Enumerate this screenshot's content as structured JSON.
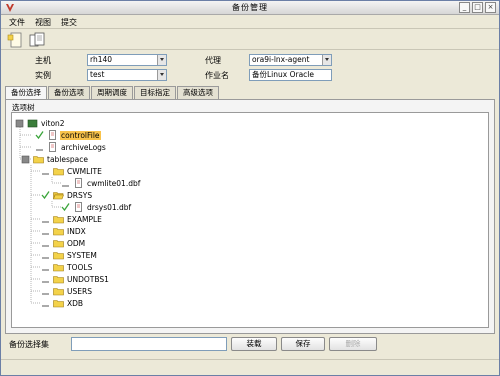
{
  "window": {
    "title": "备份管理",
    "buttons": {
      "minimize": "_",
      "maximize": "□",
      "close": "×"
    }
  },
  "menu": {
    "file": "文件",
    "view": "视图",
    "submit": "提交"
  },
  "toolbar": {
    "icons": [
      "new-doc-icon",
      "docs-icon"
    ]
  },
  "form": {
    "host_label": "主机",
    "host_value": "rh140",
    "agent_label": "代理",
    "agent_value": "ora9i-lnx-agent",
    "instance_label": "实例",
    "instance_value": "test",
    "job_label": "作业名",
    "job_value": "备份Linux Oracle"
  },
  "tabs": [
    "备份选择",
    "备份选项",
    "周期调度",
    "目标指定",
    "高级选项"
  ],
  "tree": {
    "group_label": "选项树",
    "nodes": [
      {
        "label": "viton2",
        "type": "db",
        "checked": "partial"
      },
      {
        "label": "controlFile",
        "type": "file",
        "checked": true,
        "selected": true
      },
      {
        "label": "archiveLogs",
        "type": "file",
        "checked": false
      },
      {
        "label": "tablespace",
        "type": "folder",
        "checked": "partial"
      },
      {
        "label": "CWMLITE",
        "type": "folder",
        "checked": false
      },
      {
        "label": "cwmlite01.dbf",
        "type": "file",
        "checked": false
      },
      {
        "label": "DRSYS",
        "type": "folder-open",
        "checked": true
      },
      {
        "label": "drsys01.dbf",
        "type": "file",
        "checked": true
      },
      {
        "label": "EXAMPLE",
        "type": "folder",
        "checked": false
      },
      {
        "label": "INDX",
        "type": "folder",
        "checked": false
      },
      {
        "label": "ODM",
        "type": "folder",
        "checked": false
      },
      {
        "label": "SYSTEM",
        "type": "folder",
        "checked": false
      },
      {
        "label": "TOOLS",
        "type": "folder",
        "checked": false
      },
      {
        "label": "UNDOTBS1",
        "type": "folder",
        "checked": false
      },
      {
        "label": "USERS",
        "type": "folder",
        "checked": false
      },
      {
        "label": "XDB",
        "type": "folder",
        "checked": false
      }
    ]
  },
  "bottom": {
    "set_label": "备份选择集",
    "set_value": "",
    "load_button": "装载",
    "save_button": "保存",
    "delete_button": "删除"
  },
  "colors": {
    "selection": "#f9c34b",
    "folder": "#f3d24a",
    "check": "#3aa53a"
  }
}
